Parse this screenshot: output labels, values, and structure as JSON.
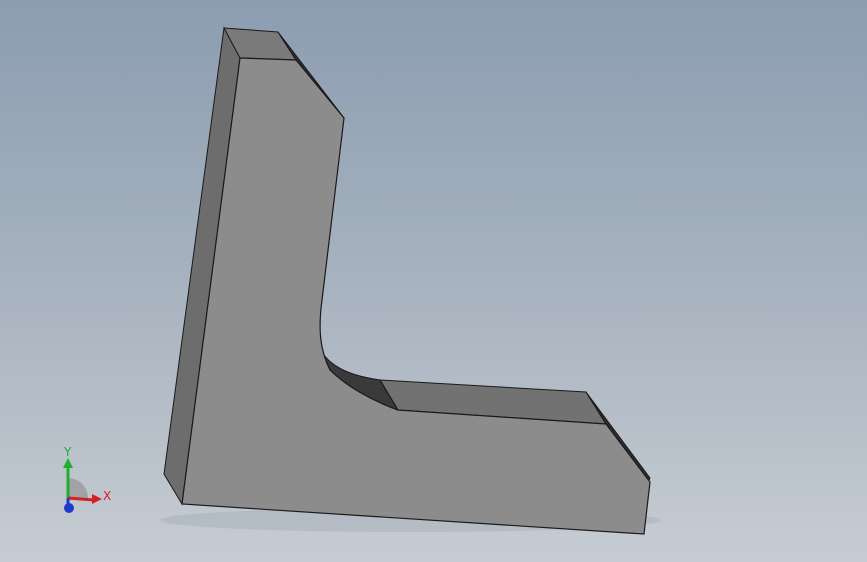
{
  "viewport": {
    "colors": {
      "background_top": "#8b9db1",
      "background_bottom": "#c6ccd3",
      "part_front_face": "#8c8c8c",
      "part_side_face": "#6d6d6d",
      "part_top_face": "#7a7a7a",
      "part_dark_chamfer": "#2d2d2d",
      "edge_line": "#1a1a1a"
    }
  },
  "triad": {
    "x_label": "X",
    "y_label": "Y",
    "colors": {
      "x_axis": "#d42020",
      "y_axis": "#1fae2d",
      "z_axis": "#1c3ccf"
    }
  }
}
